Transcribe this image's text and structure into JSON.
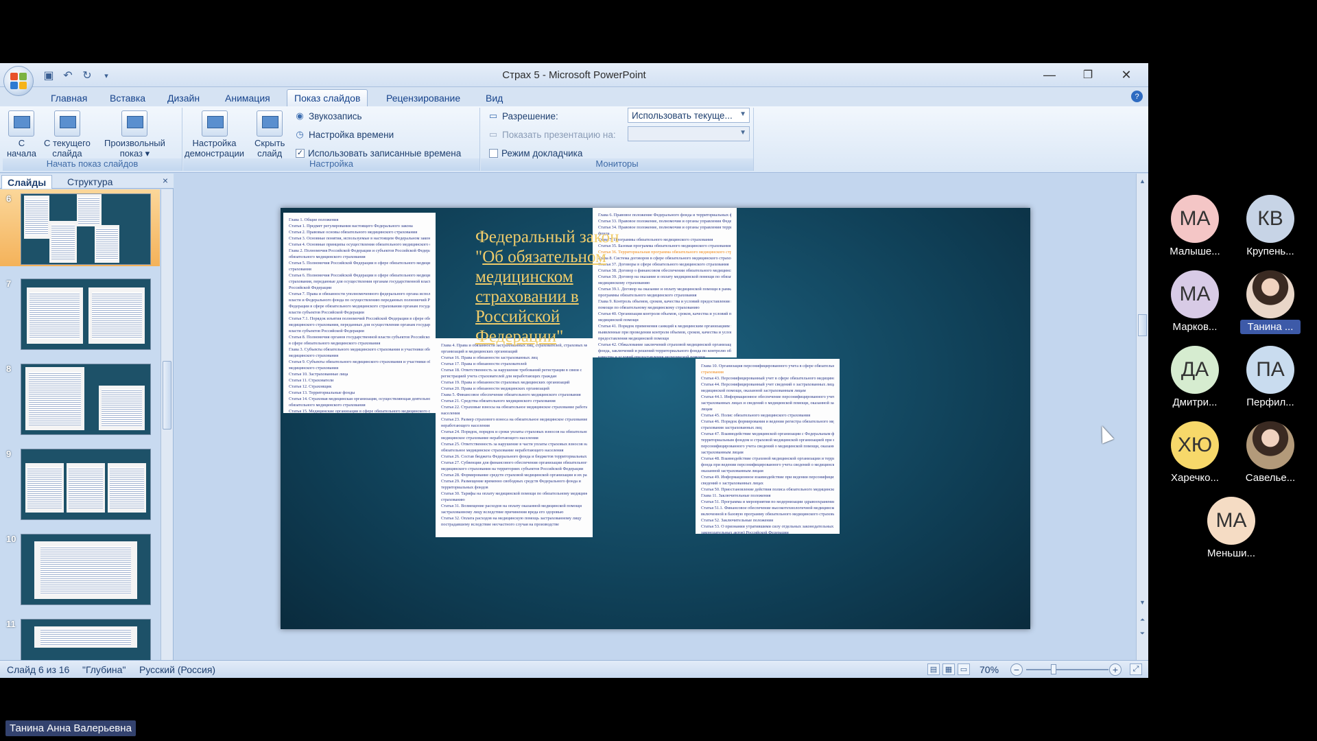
{
  "window": {
    "title": "Страх 5 - Microsoft PowerPoint",
    "minimize": "—",
    "restore": "❐",
    "close": "✕"
  },
  "quick_access": [
    "save-icon",
    "undo-icon",
    "redo-icon",
    "customize-icon"
  ],
  "ribbon": {
    "tabs": [
      "Главная",
      "Вставка",
      "Дизайн",
      "Анимация",
      "Показ слайдов",
      "Рецензирование",
      "Вид"
    ],
    "active_tab": "Показ слайдов",
    "help": "?",
    "groups": {
      "start": {
        "label": "Начать показ слайдов",
        "from_start": "С\nначала",
        "from_current": "С текущего\nслайда",
        "custom": "Произвольный\nпоказ ▾"
      },
      "setup": {
        "label": "Настройка",
        "setup_show": "Настройка\nдемонстрации",
        "hide_slide": "Скрыть\nслайд",
        "record": "Звукозапись",
        "timings": "Настройка времени",
        "use_timings": "Использовать записанные времена",
        "use_timings_checked": "✓"
      },
      "monitors": {
        "label": "Мониторы",
        "resolution_label": "Разрешение:",
        "resolution_value": "Использовать текуще...",
        "show_on_label": "Показать презентацию на:",
        "presenter_view": "Режим докладчика"
      }
    }
  },
  "slide_panel": {
    "tabs": [
      "Слайды",
      "Структура"
    ],
    "close": "×",
    "thumbnails": [
      "6",
      "7",
      "8",
      "9",
      "10",
      "11"
    ],
    "selected": "6"
  },
  "slide": {
    "title_line1": "Федеральный закон",
    "title_quote_open": "\"",
    "title_link": "Об обязательном медицинском страховании в Российской Федерации",
    "title_quote_close": "\"",
    "col1": [
      "Глава 1. Общие положения",
      "Статья 1. Предмет регулирования настоящего Федерального закона",
      "Статья 2. Правовые основы обязательного медицинского страхования",
      "Статья 3. Основные понятия, используемые в настоящем Федеральном законе",
      "Статья 4. Основные принципы осуществления обязательного медицинского страхования",
      "Глава 2. Полномочия Российской Федерации и субъектов Российской Федерации в сфере",
      "обязательного медицинского страхования",
      "Статья 5. Полномочия Российской Федерации в сфере обязательного медицинского",
      "страхования",
      "Статья 6. Полномочия Российской Федерации в сфере обязательного медицинского",
      "страхования, переданные для осуществления органам государственной власти субъектов",
      "Российской Федерации",
      "Статья 7. Права и обязанности уполномоченного федерального органа исполнительной",
      "власти и Федерального фонда по осуществлению переданных полномочий Российской",
      "Федерации в сфере обязательного медицинского страхования органам государственной",
      "власти субъектов Российской Федерации",
      "Статья 7.1. Порядок изъятия полномочий Российской Федерации в сфере обязательного",
      "медицинского страхования, переданных для осуществления органам государственной",
      "власти субъектов Российской Федерации",
      "Статья 8. Полномочия органов государственной власти субъектов Российской Федерации",
      "в сфере обязательного медицинского страхования",
      "Глава 3. Субъекты обязательного медицинского страхования и участники обязательного",
      "медицинского страхования",
      "Статья 9. Субъекты обязательного медицинского страхования и участники обязательного",
      "медицинского страхования",
      "Статья 10. Застрахованные лица",
      "Статья 11. Страхователи",
      "Статья 12. Страховщик",
      "Статья 13. Территориальные фонды",
      "Статья 14. Страховая медицинская организация, осуществляющая деятельность в сфере",
      "обязательного медицинского страхования",
      "Статья 15. Медицинские организации в сфере обязательного медицинского страхования"
    ],
    "col2": [
      "Глава 4. Права и обязанности застрахованных лиц, страхователей, страховых медицинских",
      "организаций и медицинских организаций",
      "Статья 16. Права и обязанности застрахованных лиц",
      "Статья 17. Права и обязанности страхователей",
      "Статья 18. Ответственность за нарушение требований регистрации в связи с",
      "регистрацией учета страхователей для неработающих граждан",
      "Статья 19. Права и обязанности страховых медицинских организаций",
      "Статья 20. Права и обязанности медицинских организаций",
      "Глава 5. Финансовое обеспечение обязательного медицинского страхования",
      "Статья 21. Средства обязательного медицинского страхования",
      "Статья 22. Страховые взносы на обязательное медицинское страхование работающего",
      "населения",
      "Статья 23. Размер страхового взноса на обязательное медицинское страхование",
      "неработающего населения",
      "Статья 24. Порядок, порядок и сроки уплаты страховых взносов на обязательное",
      "медицинское страхование неработающего населения",
      "Статья 25. Ответственность за нарушение в части уплаты страховых взносов на",
      "обязательное медицинское страхование неработающего населения",
      "Статья 26. Состав бюджета Федерального фонда и бюджетов территориальных фондов",
      "Статья 27. Субвенции для финансового обеспечения организации обязательного",
      "медицинского страхования на территориях субъектов Российской Федерации",
      "Статья 28. Формирование средств страховой медицинской организации и их расходование",
      "Статья 29. Размещение временно свободных средств Федерального фонда и",
      "территориальных фондов",
      "Статья 30. Тарифы на оплату медицинской помощи по обязательному медицинскому",
      "страхованию",
      "Статья 31. Возмещение расходов на оплату оказанной медицинской помощи",
      "застрахованному лицу вследствие причинения вреда его здоровью",
      "Статья 32. Оплата расходов на медицинскую помощь застрахованному лицу",
      "пострадавшему вследствие несчастного случая на производстве"
    ],
    "col3": [
      "Глава 6. Правовое положение Федерального фонда и территориальных фондов",
      "Статья 33. Правовое положение, полномочия и органы управления Федерального фонда",
      "Статья 34. Правовое положение, полномочия и органы управления территориального",
      "фонда",
      "Глава 7. Программы обязательного медицинского страхования",
      "Статья 35. Базовая программа обязательного медицинского страхования",
      "Статья 36. Территориальная программа обязательного медицинского страхования",
      "Глава 8. Система договоров в сфере обязательного медицинского страхования",
      "Статья 37. Договоры в сфере обязательного медицинского страхования",
      "Статья 38. Договор о финансовом обеспечении обязательного медицинского страхования",
      "Статья 39. Договор на оказание и оплату медицинской помощи по обязательному",
      "медицинскому страхованию",
      "Статья 39.1. Договор на оказание и оплату медицинской помощи в рамках базовой",
      "программы обязательного медицинского страхования",
      "Глава 9. Контроль объемов, сроков, качества и условий предоставления медицинской",
      "помощи по обязательному медицинскому страхованию",
      "Статья 40. Организация контроля объемов, сроков, качества и условий предоставления",
      "медицинской помощи",
      "Статья 41. Порядок применения санкций к медицинским организациям за нарушения,",
      "выявленные при проведении контроля объемов, сроков, качества и условий",
      "предоставления медицинской помощи",
      "Статья 42. Обжалование заключений страховой медицинской организации и Федерального",
      "фонда, заключений и решений территориального фонда по контролю объемов, сроков,",
      "качества и условий предоставления медицинской помощи"
    ],
    "col4": [
      "Глава 10. Организация персонифицированного учета в сфере обязательного медицинского",
      "страхования",
      "Статья 43. Персонифицированный учет в сфере обязательного медицинского страхования",
      "Статья 44. Персонифицированный учет сведений о застрахованных лицах и сведений о",
      "медицинской помощи, оказанной застрахованным лицам",
      "Статья 44.1. Информационное обеспечение персонифицированного учета сведений о",
      "застрахованных лицах и сведений о медицинской помощи, оказанной застрахованным",
      "лицам",
      "Статья 45. Полис обязательного медицинского страхования",
      "Статья 46. Порядок формирования и ведения регистра обязательного медицинского",
      "страхования застрахованных лиц",
      "Статья 47. Взаимодействие медицинской организации с Федеральным фондом,",
      "территориальным фондом и страховой медицинской организацией при ведении",
      "персонифицированного учета сведений о медицинской помощи, оказанной",
      "застрахованным лицам",
      "Статья 48. Взаимодействие страховой медицинской организации и территориального",
      "фонда при ведении персонифицированного учета сведений о медицинской помощи,",
      "оказанной застрахованным лицам",
      "Статья 49. Информационное взаимодействие при ведении персонифицированного учета",
      "сведений о застрахованных лицах",
      "Статья 50. Приостановление действия полиса обязательного медицинского страхования",
      "Глава 11. Заключительные положения",
      "Статья 51. Программа и мероприятия по модернизации здравоохранения",
      "Статья 51.1. Финансовое обеспечение высокотехнологичной медицинской помощи, не",
      "включенной в базовую программу обязательного медицинского страхования",
      "Статья 52. Заключительные положения",
      "Статья 53. О признании утратившими силу отдельных законодательных актов (положений",
      "законодательных актов) Российской Федерации",
      "Статья 54. Порядок вступления в силу настоящего Федерального закона"
    ]
  },
  "status": {
    "slide_of": "Слайд 6 из 16",
    "theme": "\"Глубина\"",
    "language": "Русский (Россия)",
    "zoom": "70%",
    "zoom_out": "−",
    "zoom_in": "+"
  },
  "participants": [
    {
      "initials": "МА",
      "name": "Малыше...",
      "color": "#f4c6c6"
    },
    {
      "initials": "КВ",
      "name": "Крупень...",
      "color": "#c7d4e6"
    },
    {
      "initials": "МА",
      "name": "Марков...",
      "color": "#d8cbe6"
    },
    {
      "initials": "",
      "name": "Танина ...",
      "color": "#e9d6c8"
    },
    {
      "initials": "ДА",
      "name": "Дмитри...",
      "color": "#d6ecd0"
    },
    {
      "initials": "ПА",
      "name": "Перфил...",
      "color": "#c9dcef"
    },
    {
      "initials": "ХЮ",
      "name": "Харечко...",
      "color": "#f7d86a"
    },
    {
      "initials": "",
      "name": "Савелье...",
      "color": "#b39a7a"
    },
    {
      "initials": "МА",
      "name": "Меньши...",
      "color": "#f5dcc4"
    }
  ],
  "speaker": "Танина Анна Валерьевна",
  "colors": {
    "ribbon_blue": "#15428b",
    "slide_teal": "#0f3e55",
    "title_gold": "#f0cc6a",
    "highlight_orange": "#f08a1a",
    "selected_thumb": "#f4b25a"
  }
}
